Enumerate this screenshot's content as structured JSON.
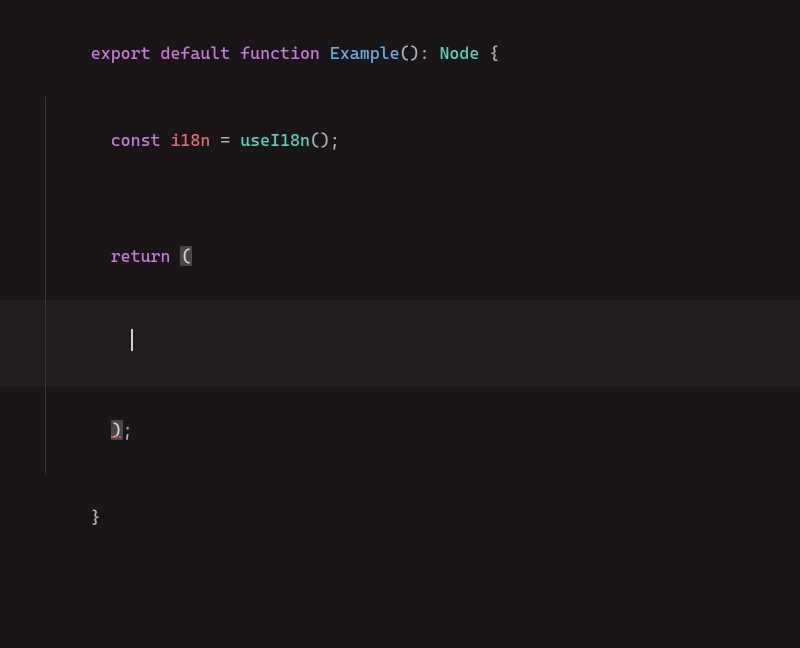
{
  "code": {
    "line1": {
      "kw_export": "export",
      "kw_default": "default",
      "kw_function": "function",
      "fn_name": "Example",
      "parens": "()",
      "colon": ":",
      "type": "Node",
      "brace_open": "{"
    },
    "line2": {
      "kw_const": "const",
      "var_name": "i18n",
      "eq": "=",
      "fn_call": "useI18n",
      "parens": "()",
      "semi": ";"
    },
    "line4": {
      "kw_return": "return",
      "paren_open": "("
    },
    "line6": {
      "paren_close": ")",
      "semi": ";"
    },
    "line7": {
      "brace_close": "}"
    }
  }
}
